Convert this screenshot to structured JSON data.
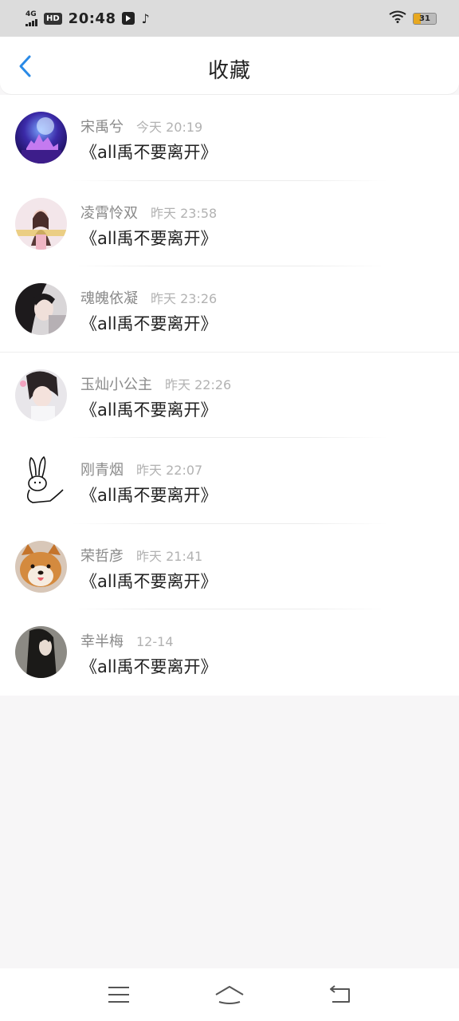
{
  "status_bar": {
    "network": "4G",
    "hd": "HD",
    "time": "20:48",
    "battery": "31"
  },
  "header": {
    "title": "收藏"
  },
  "favorites": [
    {
      "username": "宋禹兮",
      "time": "今天 20:19",
      "content": "《all禹不要离开》",
      "avatar_icon": "avatar-night-castle"
    },
    {
      "username": "凌霄怜双",
      "time": "昨天 23:58",
      "content": "《all禹不要离开》",
      "avatar_icon": "avatar-girl-pink"
    },
    {
      "username": "魂魄依凝",
      "time": "昨天 23:26",
      "content": "《all禹不要离开》",
      "avatar_icon": "avatar-girl-dark"
    },
    {
      "username": "玉灿小公主",
      "time": "昨天 22:26",
      "content": "《all禹不要离开》",
      "avatar_icon": "avatar-girl-light"
    },
    {
      "username": "刚青烟",
      "time": "昨天 22:07",
      "content": "《all禹不要离开》",
      "avatar_icon": "avatar-rabbit-sketch"
    },
    {
      "username": "荣哲彦",
      "time": "昨天 21:41",
      "content": "《all禹不要离开》",
      "avatar_icon": "avatar-shiba-dog"
    },
    {
      "username": "幸半梅",
      "time": "12-14",
      "content": "《all禹不要离开》",
      "avatar_icon": "avatar-girl-longhair"
    }
  ],
  "colors": {
    "accent": "#2a8ae6",
    "status_bar_bg": "#dcdcdc",
    "page_bg": "#f7f6f7"
  }
}
